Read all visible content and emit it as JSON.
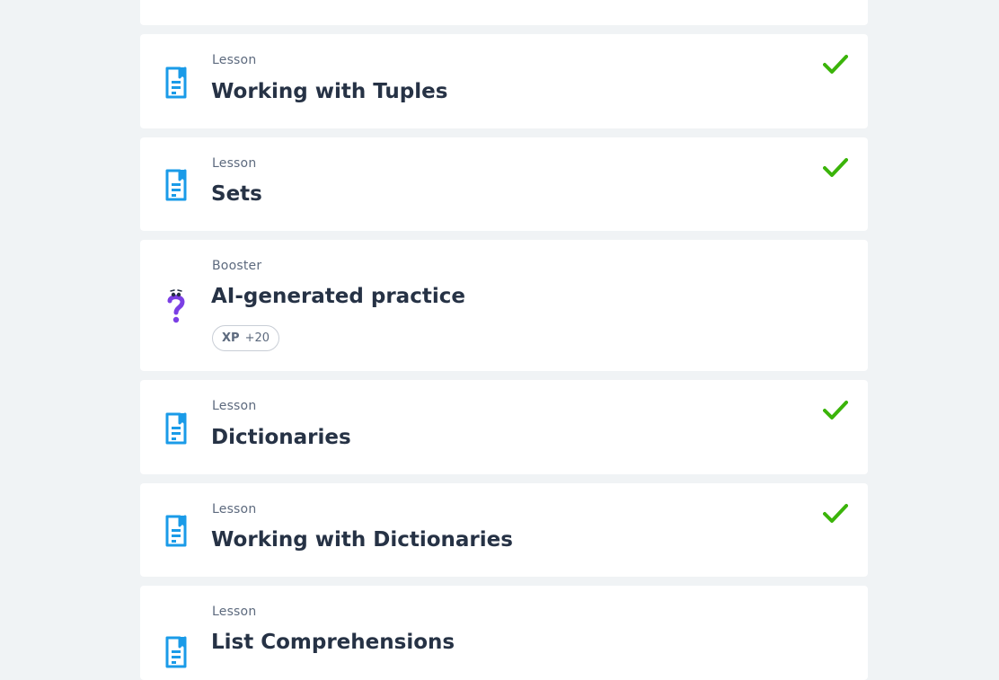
{
  "colors": {
    "page_bg": "#f0f3f5",
    "card_bg": "#ffffff",
    "lesson_icon": "#1a9be8",
    "booster_icon": "#7b3fe4",
    "check": "#3bb40a",
    "title_text": "#263245",
    "meta_text": "#5d6a7e"
  },
  "items": [
    {
      "kind": "Lesson",
      "title": "Working with Tuples",
      "icon": "lesson-document-icon",
      "completed": true
    },
    {
      "kind": "Lesson",
      "title": "Sets",
      "icon": "lesson-document-icon",
      "completed": true
    },
    {
      "kind": "Booster",
      "title": "AI-generated practice",
      "icon": "question-mark-mascot-icon",
      "completed": false,
      "xp_label": "XP",
      "xp_value": "+20"
    },
    {
      "kind": "Lesson",
      "title": "Dictionaries",
      "icon": "lesson-document-icon",
      "completed": true
    },
    {
      "kind": "Lesson",
      "title": "Working with Dictionaries",
      "icon": "lesson-document-icon",
      "completed": true
    },
    {
      "kind": "Lesson",
      "title": "List Comprehensions",
      "icon": "lesson-document-icon",
      "completed": false
    }
  ]
}
